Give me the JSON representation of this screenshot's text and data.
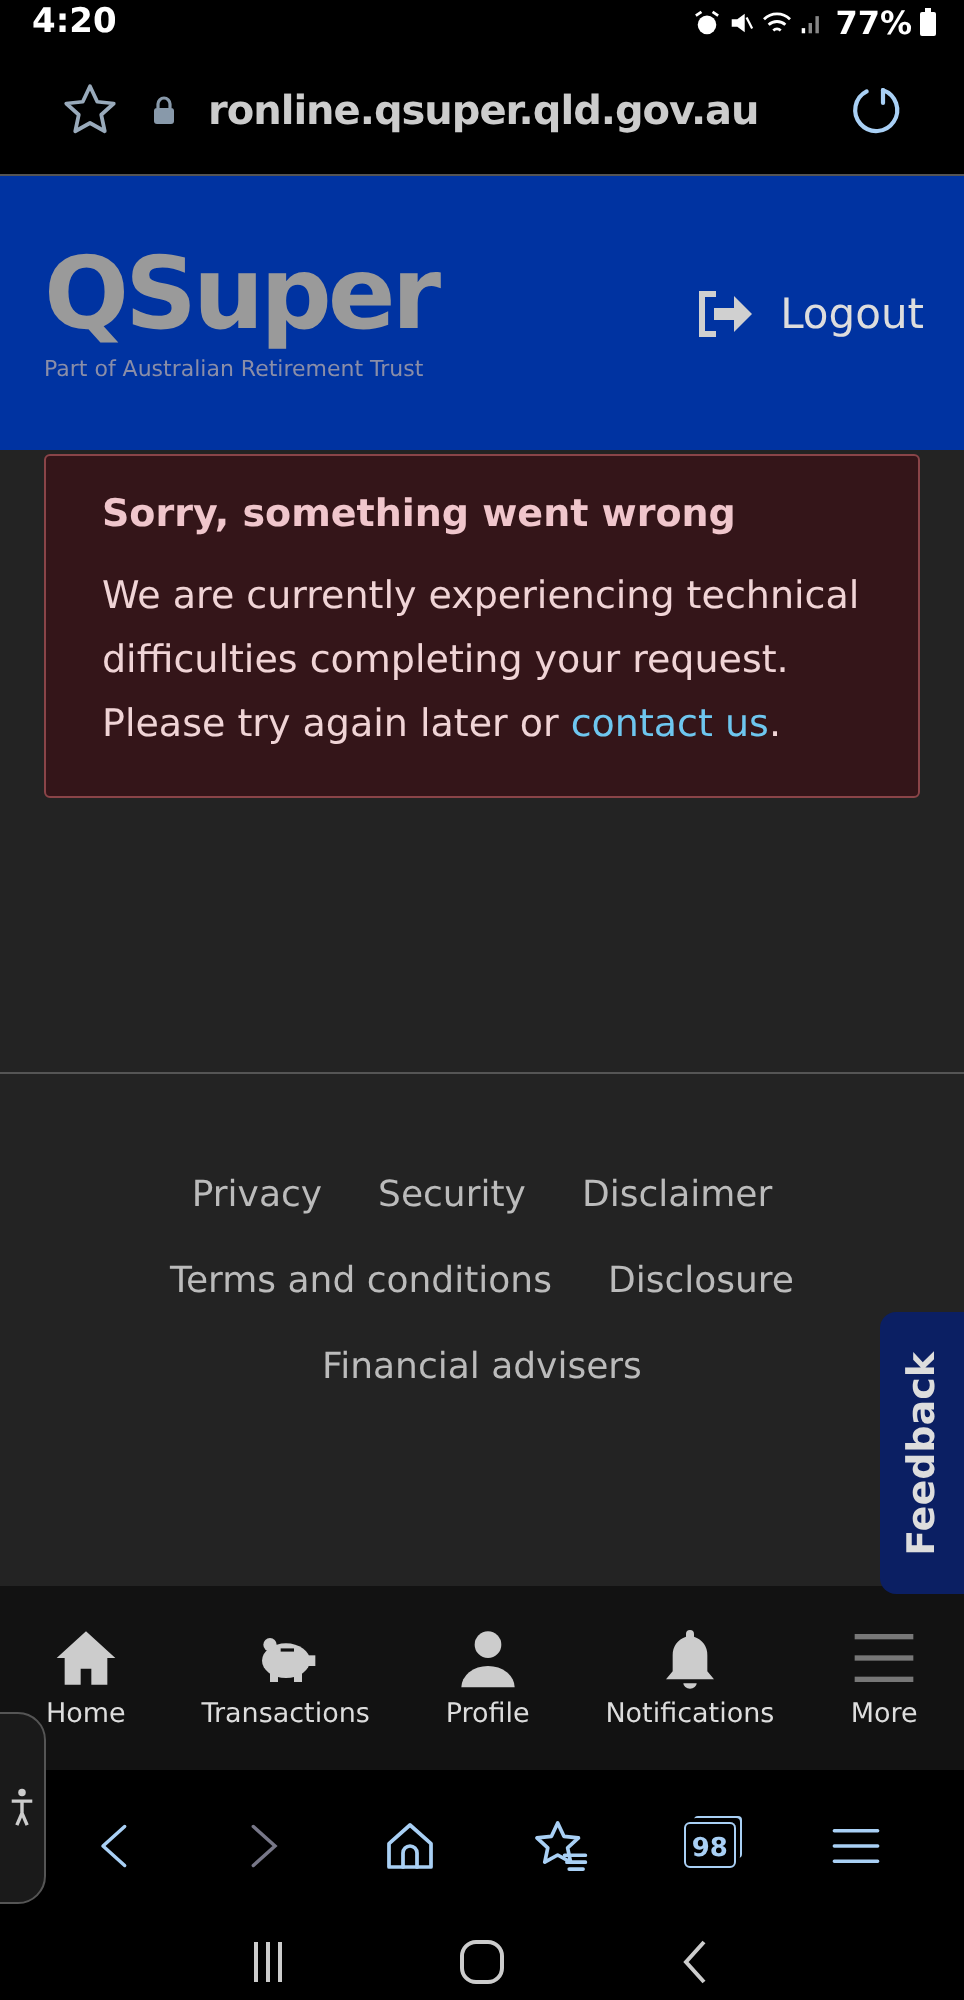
{
  "status_bar": {
    "time": "4:20",
    "battery": "77%"
  },
  "browser": {
    "url": "ronline.qsuper.qld.gov.au",
    "tab_count": "98"
  },
  "header": {
    "logo": "QSuper",
    "tagline": "Part of Australian Retirement Trust",
    "logout": "Logout"
  },
  "error": {
    "title": "Sorry, something went wrong",
    "message": "We are currently experiencing technical difficulties completing your request.  Please try again later or ",
    "link": "contact us",
    "message_end": "."
  },
  "footer": {
    "link_rows": [
      {
        "links": [
          "Privacy",
          "Security",
          "Disclaimer"
        ]
      },
      {
        "links": [
          "Terms and conditions",
          "Disclosure"
        ]
      },
      {
        "links": [
          "Financial advisers"
        ]
      }
    ]
  },
  "feedback": "Feedback",
  "bottom_nav": [
    {
      "kind": "home",
      "label": "Home"
    },
    {
      "kind": "piggy",
      "label": "Transactions"
    },
    {
      "kind": "person",
      "label": "Profile"
    },
    {
      "kind": "bell",
      "label": "Notifications"
    },
    {
      "kind": "menu",
      "label": "More"
    }
  ]
}
